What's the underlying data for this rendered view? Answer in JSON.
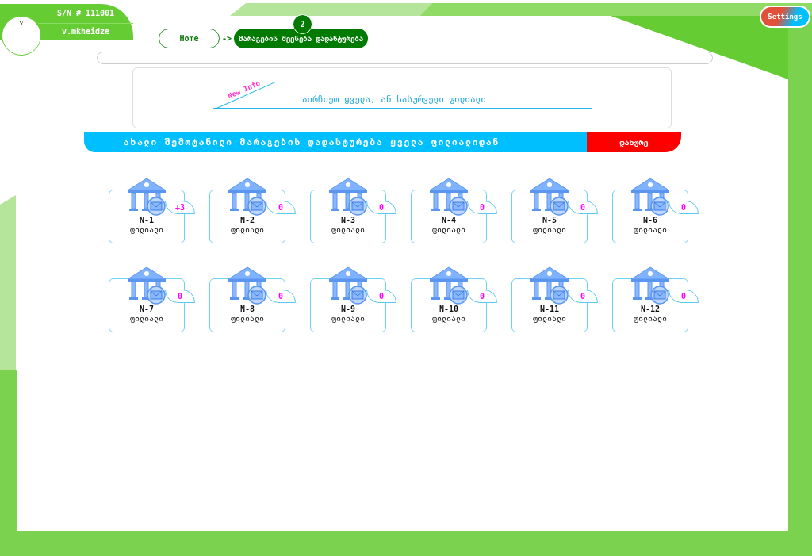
{
  "header": {
    "serial": "S/N # 111001",
    "username": "v.mkheidze",
    "avatar_initial": "V"
  },
  "breadcrumb": {
    "home": "Home",
    "arrow": "->",
    "current": "მარაგების შევსება დადასტურება",
    "step": "2"
  },
  "settings_button": "Settings",
  "info": {
    "tag": "New Info",
    "message": "აირჩიეთ ყველა, ან სასურველი ფილიალი"
  },
  "action_bar": {
    "title": "ახალი შემოტანილი მარაგების დადასტურება ყველა ფილიალიდან",
    "close_button": "დახურე"
  },
  "branches": [
    {
      "number": "N-1",
      "label": "ფილიალი",
      "count": "+3"
    },
    {
      "number": "N-2",
      "label": "ფილიალი",
      "count": "0"
    },
    {
      "number": "N-3",
      "label": "ფილიალი",
      "count": "0"
    },
    {
      "number": "N-4",
      "label": "ფილიალი",
      "count": "0"
    },
    {
      "number": "N-5",
      "label": "ფილიალი",
      "count": "0"
    },
    {
      "number": "N-6",
      "label": "ფილიალი",
      "count": "0"
    },
    {
      "number": "N-7",
      "label": "ფილიალი",
      "count": "0"
    },
    {
      "number": "N-8",
      "label": "ფილიალი",
      "count": "0"
    },
    {
      "number": "N-9",
      "label": "ფილიალი",
      "count": "0"
    },
    {
      "number": "N-10",
      "label": "ფილიალი",
      "count": "0"
    },
    {
      "number": "N-11",
      "label": "ფილიალი",
      "count": "0"
    },
    {
      "number": "N-12",
      "label": "ფილიალი",
      "count": "0"
    }
  ]
}
